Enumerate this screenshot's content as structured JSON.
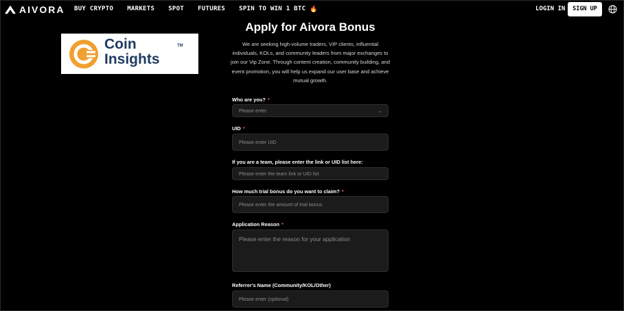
{
  "nav": {
    "brand": "AIVORA",
    "links": [
      "BUY CRYPTO",
      "MARKETS",
      "SPOT",
      "FUTURES"
    ],
    "promo": "SPIN TO WIN 1 BTC",
    "login": "LOGIN IN",
    "signup": "SIGN UP"
  },
  "ad": {
    "line1": "Coin",
    "line2": "Insights",
    "tm": "TM",
    "brand_color": "#f0a030"
  },
  "form": {
    "title": "Apply for Aivora Bonus",
    "description": "We are seeking high-volume traders, VIP clients, influential individuals, KOLs, and community leaders from major exchanges to join our Vip Zone. Through content creation, community building, and event promotion, you will help us expand our user base and achieve mutual growth.",
    "required_mark": "*",
    "fields": [
      {
        "label": "Who are you?",
        "placeholder": "Please enter"
      },
      {
        "label": "UID",
        "placeholder": "Please enter UID"
      },
      {
        "label": "If you are a team, please enter the link or UID list here:",
        "placeholder": "Please enter the team link or UID list"
      },
      {
        "label": "How much trial bonus do you want to claim?",
        "placeholder": "Please enter the amount of trial bonus"
      },
      {
        "label": "Application Reason",
        "placeholder": "Please enter the reason for your application"
      },
      {
        "label": "Referrer's Name (Community/KOL/Other)",
        "placeholder": "Please enter (optional)"
      }
    ]
  },
  "colors": {
    "background": "#000000",
    "field_bg": "#1b1b1b",
    "required": "#e35a5a"
  }
}
